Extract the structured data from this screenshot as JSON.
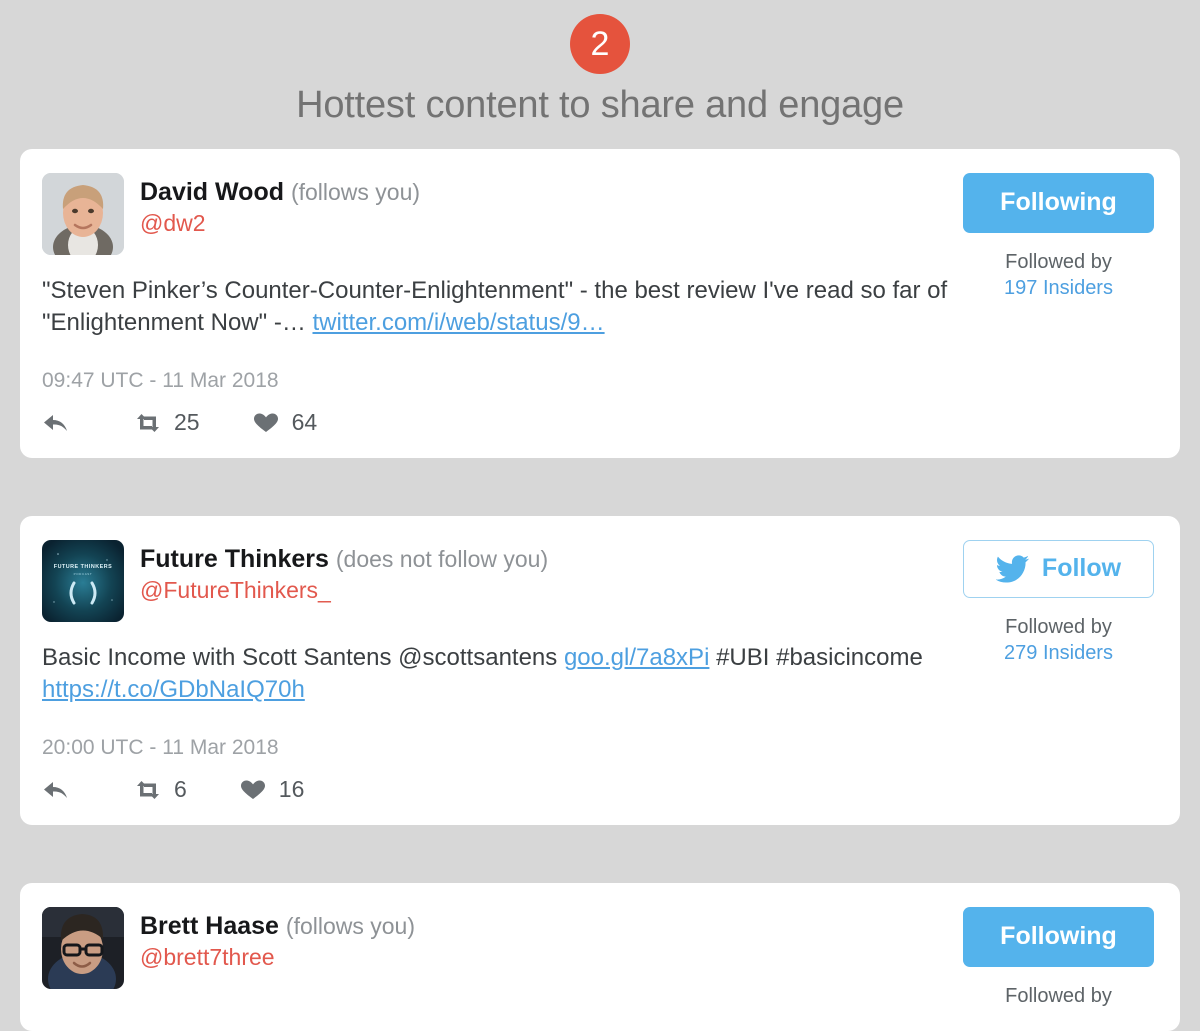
{
  "header": {
    "step_number": "2",
    "title": "Hottest content to share and engage",
    "badge_color": "#e5533d",
    "title_color": "#737373"
  },
  "theme": {
    "page_background": "#d7d7d7",
    "card_background": "#ffffff",
    "link_blue": "#4d9fe0",
    "handle_red": "#e2584d",
    "button_blue": "#54b3ec"
  },
  "tweets": [
    {
      "display_name": "David Wood",
      "follow_state": "(follows you)",
      "handle": "@dw2",
      "avatar_name": "avatar-david-wood",
      "text_plain": "\"Steven Pinker’s Counter-Counter-Enlightenment\" - the best review I've read so far of \"Enlightenment Now\" -…",
      "text_segments": [
        {
          "kind": "text",
          "value": "\"Steven Pinker’s Counter-Counter-Enlightenment\" - the best review I've read so far of \"Enlightenment Now\" -… "
        },
        {
          "kind": "link",
          "value": "twitter.com/i/web/status/9…",
          "underline": false
        }
      ],
      "timestamp": "09:47 UTC - 11 Mar 2018",
      "reply_icon": "reply-arrow-icon",
      "retweet_icon": "retweet-icon",
      "like_icon": "heart-icon",
      "retweets": "25",
      "likes": "64",
      "follow_button": {
        "label": "Following",
        "style": "filled",
        "icon": null
      },
      "followed_by_label": "Followed by",
      "followed_by_count": "197 Insiders"
    },
    {
      "display_name": "Future Thinkers",
      "follow_state": "(does not follow you)",
      "handle": "@FutureThinkers_",
      "avatar_name": "avatar-future-thinkers",
      "text_plain": "Basic Income with Scott Santens @scottsantens goo.gl/7a8xPi #UBI #basicincome https://t.co/GDbNaIQ70h",
      "text_segments": [
        {
          "kind": "text",
          "value": "Basic Income with Scott Santens @scottsantens "
        },
        {
          "kind": "link",
          "value": "goo.gl/7a8xPi",
          "underline": false
        },
        {
          "kind": "text",
          "value": " #UBI #basicincome "
        },
        {
          "kind": "link",
          "value": "https://t.co/GDbNaIQ70h",
          "underline": true
        }
      ],
      "timestamp": "20:00 UTC - 11 Mar 2018",
      "reply_icon": "reply-arrow-icon",
      "retweet_icon": "retweet-icon",
      "like_icon": "heart-icon",
      "retweets": "6",
      "likes": "16",
      "follow_button": {
        "label": "Follow",
        "style": "outline",
        "icon": "twitter-bird-icon"
      },
      "followed_by_label": "Followed by",
      "followed_by_count": "279 Insiders"
    },
    {
      "display_name": "Brett Haase",
      "follow_state": "(follows you)",
      "handle": "@brett7three",
      "avatar_name": "avatar-brett-haase",
      "text_plain": "",
      "text_segments": [],
      "timestamp": "",
      "reply_icon": "reply-arrow-icon",
      "retweet_icon": "retweet-icon",
      "like_icon": "heart-icon",
      "retweets": "",
      "likes": "",
      "follow_button": {
        "label": "Following",
        "style": "filled",
        "icon": null
      },
      "followed_by_label": "Followed by",
      "followed_by_count": ""
    }
  ]
}
